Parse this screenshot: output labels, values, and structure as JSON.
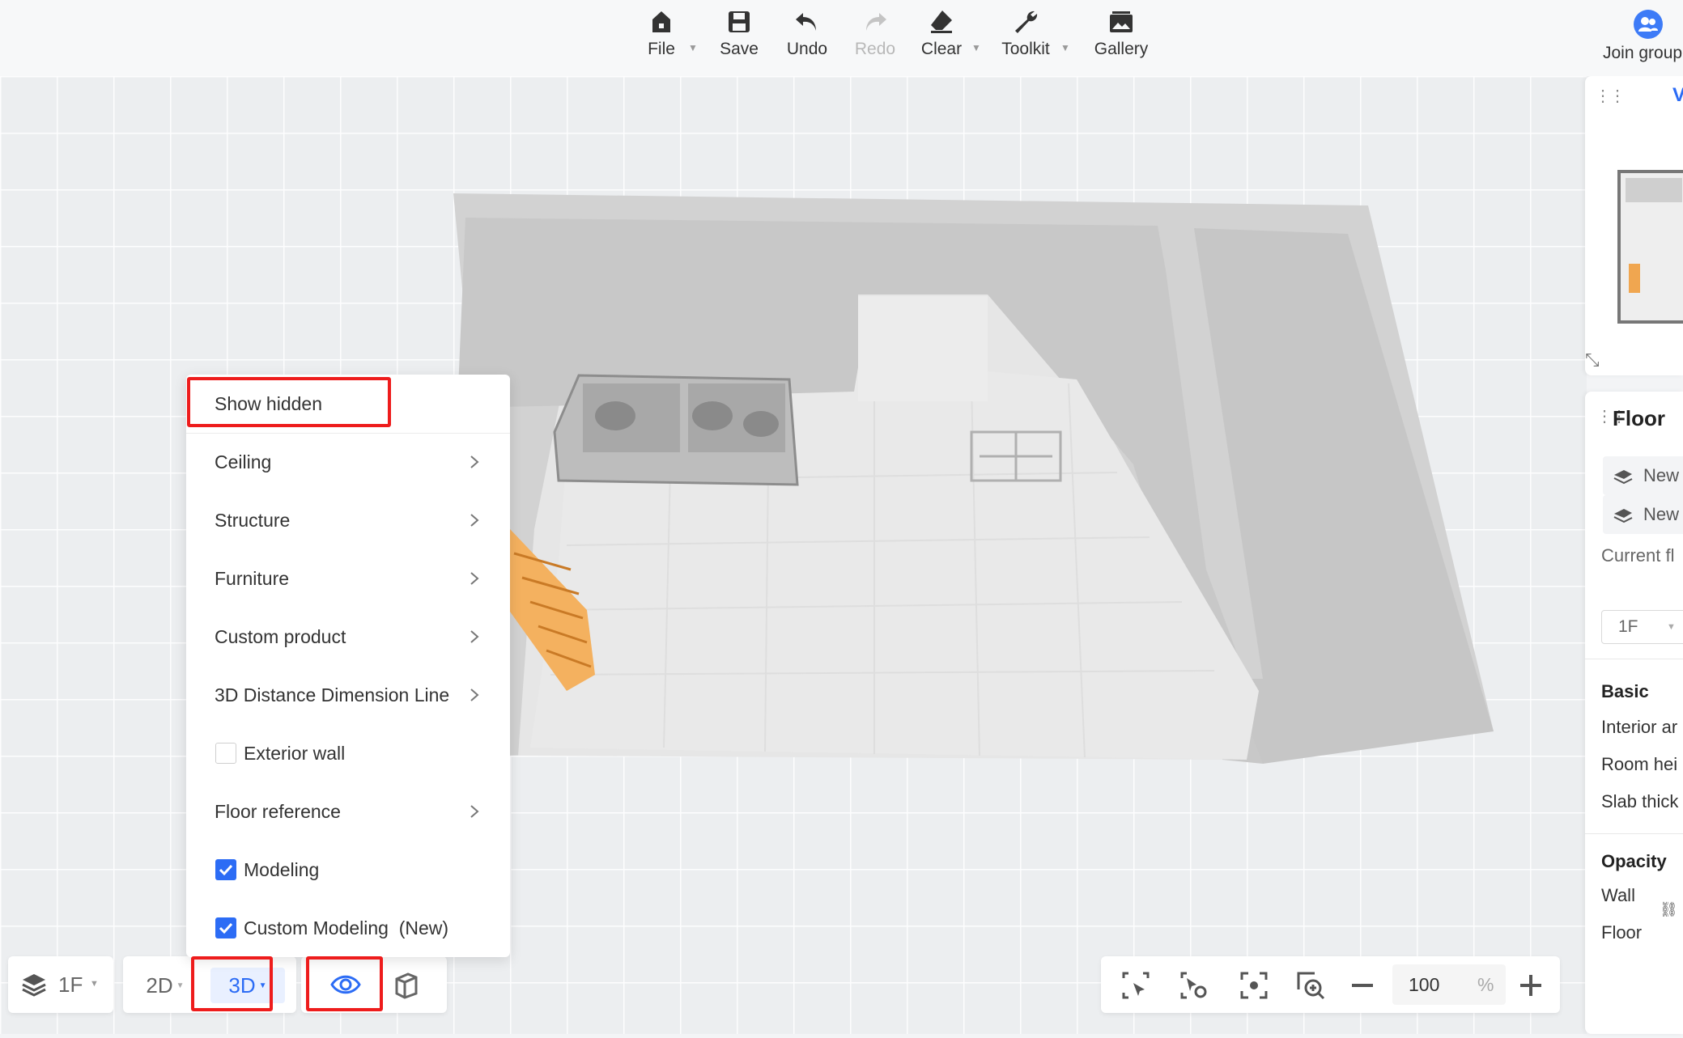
{
  "toolbar": {
    "items": [
      {
        "label": "File",
        "icon": "home-icon",
        "has_caret": true
      },
      {
        "label": "Save",
        "icon": "save-icon",
        "has_caret": false
      },
      {
        "label": "Undo",
        "icon": "undo-icon",
        "has_caret": false
      },
      {
        "label": "Redo",
        "icon": "redo-icon",
        "has_caret": false,
        "disabled": true
      },
      {
        "label": "Clear",
        "icon": "eraser-icon",
        "has_caret": true
      },
      {
        "label": "Toolkit",
        "icon": "wrench-icon",
        "has_caret": true
      },
      {
        "label": "Gallery",
        "icon": "gallery-icon",
        "has_caret": false
      }
    ],
    "join_group": "Join group"
  },
  "right_panel": {
    "tab_letter": "V",
    "title": "Floor",
    "new_btn_1": "New",
    "new_btn_2": "New",
    "current_floor_label": "Current fl",
    "current_floor_value": "1F",
    "basic_section": "Basic",
    "interior_label": "Interior ar",
    "room_height_label": "Room hei",
    "slab_label": "Slab thick",
    "opacity_section": "Opacity",
    "wall_label": "Wall",
    "floor_label": "Floor"
  },
  "menu": {
    "items": [
      {
        "label": "Show hidden",
        "kind": "plain"
      },
      {
        "label": "Ceiling",
        "kind": "submenu"
      },
      {
        "label": "Structure",
        "kind": "submenu"
      },
      {
        "label": "Furniture",
        "kind": "submenu"
      },
      {
        "label": "Custom product",
        "kind": "submenu"
      },
      {
        "label": "3D Distance Dimension Line",
        "kind": "submenu"
      },
      {
        "label": "Exterior wall",
        "kind": "checkbox",
        "checked": false
      },
      {
        "label": "Floor reference",
        "kind": "submenu"
      },
      {
        "label": "Modeling",
        "kind": "checkbox",
        "checked": true
      },
      {
        "label": "Custom Modeling  (New)",
        "kind": "checkbox",
        "checked": true
      }
    ]
  },
  "bottom_left": {
    "floor_value": "1F",
    "view_2d": "2D",
    "view_3d": "3D"
  },
  "zoom": {
    "value": "100",
    "unit": "%"
  },
  "colors": {
    "accent": "#2c6cf5",
    "highlight": "#ee1c1c",
    "stairs": "#f0a650"
  }
}
